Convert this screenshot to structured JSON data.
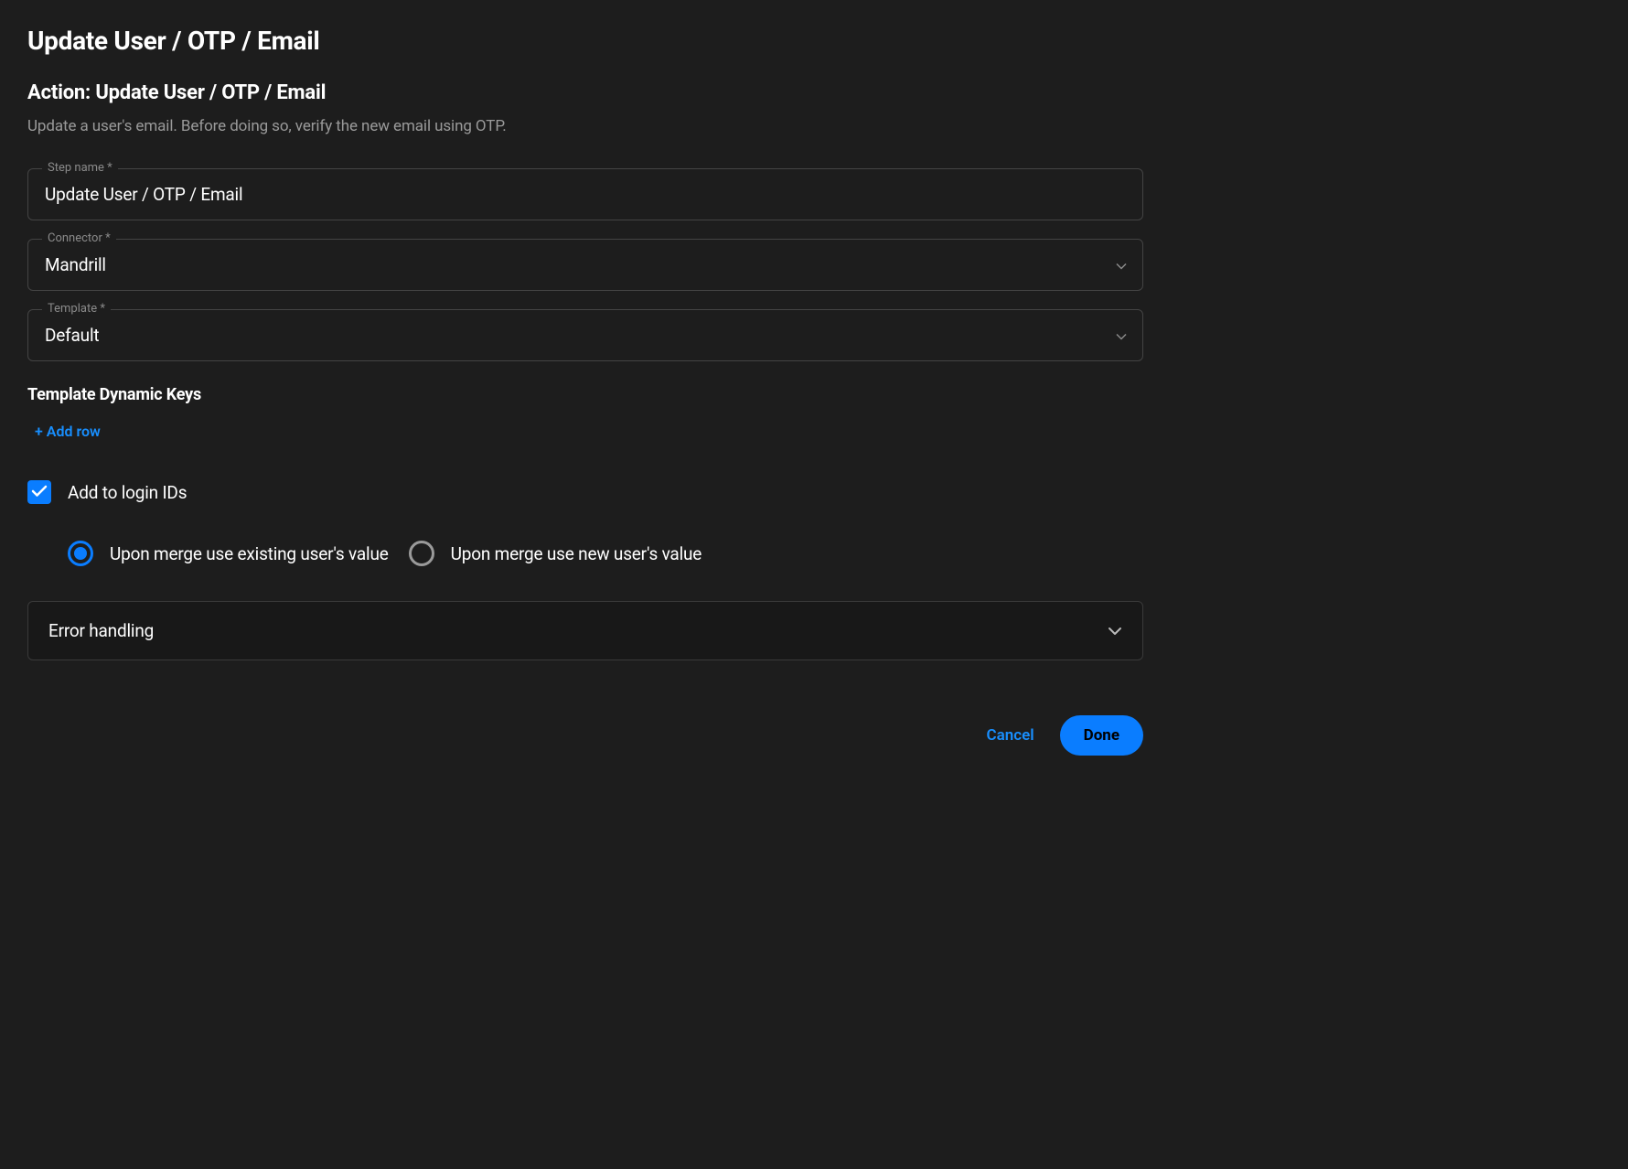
{
  "page_title": "Update User / OTP / Email",
  "action": {
    "heading": "Action: Update User / OTP / Email",
    "description": "Update a user's email. Before doing so, verify the new email using OTP."
  },
  "fields": {
    "step_name": {
      "label": "Step name *",
      "value": "Update User / OTP / Email"
    },
    "connector": {
      "label": "Connector *",
      "value": "Mandrill"
    },
    "template": {
      "label": "Template *",
      "value": "Default"
    }
  },
  "dynamic_keys": {
    "heading": "Template Dynamic Keys",
    "add_row": "+ Add row"
  },
  "checkbox": {
    "label": "Add to login IDs",
    "checked": true
  },
  "radio": {
    "option1": "Upon merge use existing user's value",
    "option2": "Upon merge use new user's value",
    "selected": 0
  },
  "accordion": {
    "title": "Error handling"
  },
  "footer": {
    "cancel": "Cancel",
    "done": "Done"
  }
}
